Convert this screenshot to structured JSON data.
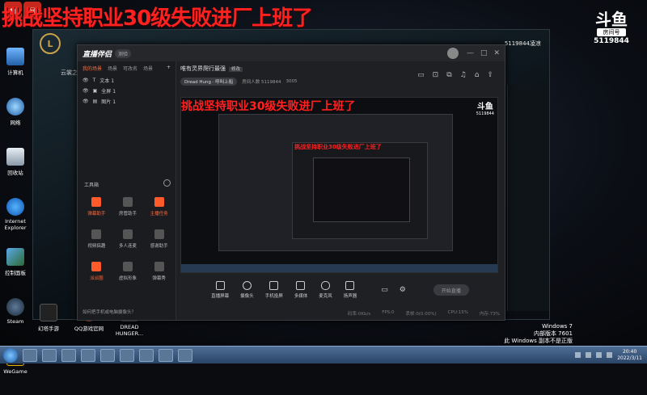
{
  "overlay": {
    "title": "挑战坚持职业30级失败进厂上班了",
    "douyu_logo": "斗鱼",
    "room_label": "房间号",
    "room_number": "5119844"
  },
  "desktop_icons": [
    {
      "label": "计算机",
      "icon": "computer-icon"
    },
    {
      "label": "网络",
      "icon": "network-icon"
    },
    {
      "label": "回收站",
      "icon": "recycle-bin-icon"
    },
    {
      "label": "Internet Explorer",
      "icon": "ie-icon"
    },
    {
      "label": "控制面板",
      "icon": "control-panel-icon"
    },
    {
      "label": "Steam",
      "icon": "steam-icon"
    },
    {
      "label": "WeGame",
      "icon": "wegame-icon"
    }
  ],
  "bottom_icons": [
    {
      "label": "幻塔手游",
      "icon": "game-icon"
    },
    {
      "label": "QQ游戏官网",
      "icon": "qq-icon"
    },
    {
      "label": "DREAD HUNGER...",
      "icon": "game-icon"
    }
  ],
  "lol_client": {
    "logo": "L",
    "uid": "5119844凌凉",
    "left_text": "云裳之"
  },
  "app": {
    "logo": "直播伴侣",
    "version": "测验",
    "window_controls": [
      "—",
      "□",
      "✕"
    ],
    "scene_tabs": [
      "我的场景",
      "场景",
      "可改名",
      "场景"
    ],
    "plus": "+",
    "layers": [
      {
        "name": "文本 1"
      },
      {
        "name": "全屏 1"
      },
      {
        "name": "图片 1"
      }
    ],
    "tools_title": "工具箱",
    "tools": [
      {
        "label": "弹幕助手",
        "active": true
      },
      {
        "label": "房管助手",
        "active": false
      },
      {
        "label": "主播任务",
        "active": true
      },
      {
        "label": "视频搞趣",
        "active": false
      },
      {
        "label": "多人连麦",
        "active": false
      },
      {
        "label": "感谢助手",
        "active": false
      },
      {
        "label": "派派圈",
        "active": true
      },
      {
        "label": "虚拟形象",
        "active": false
      },
      {
        "label": "弹幕秀",
        "active": false
      }
    ],
    "tip": "如何把手机或电脑摄像头？",
    "room_title": "唯有灵界爬行最强",
    "edit_label": "修改",
    "tag": "Dread Hung · 呼叫上船",
    "viewers_label": "房间人数 5119844",
    "hot": "3005",
    "controls": [
      {
        "label": "直播屏幕"
      },
      {
        "label": "摄像头"
      },
      {
        "label": "手机投屏"
      },
      {
        "label": "多媒体"
      },
      {
        "label": "麦克风"
      },
      {
        "label": "扬声器"
      }
    ],
    "go_live": "开始直播",
    "status": [
      "码率:0Kb/s",
      "FPS:0",
      "丢帧:0(0.00%)",
      "CPU:15%",
      "内存:73%"
    ]
  },
  "system": {
    "os_name": "Windows 7",
    "build": "内部版本 7601",
    "notice": "此 Windows 副本不是正版",
    "time": "20:40",
    "date": "2022/3/11"
  }
}
